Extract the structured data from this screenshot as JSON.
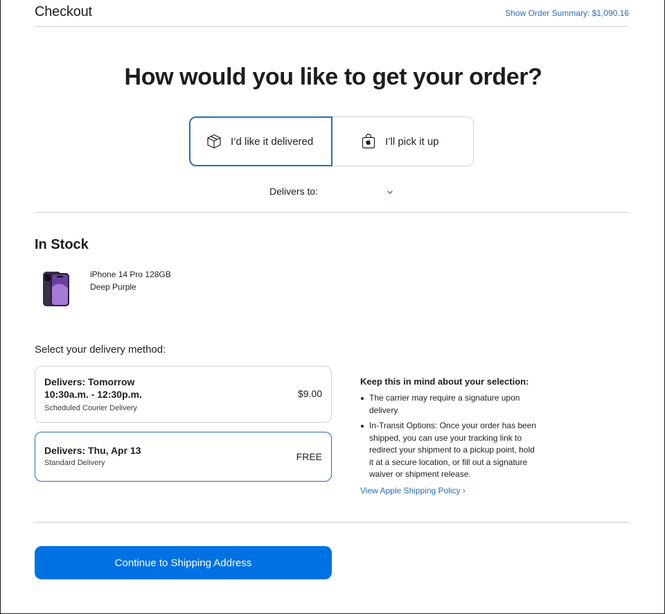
{
  "header": {
    "title": "Checkout",
    "order_summary": "Show Order Summary: $1,090.16"
  },
  "headline": "How would you like to get your order?",
  "fulfillment": {
    "deliver": {
      "label": "I’d like it delivered",
      "icon": "box-icon",
      "selected": true
    },
    "pickup": {
      "label": "I’ll pick it up",
      "icon": "apple-bag-icon",
      "selected": false
    }
  },
  "delivers_to": {
    "label": "Delivers to:",
    "value": ""
  },
  "stock": {
    "heading": "In Stock",
    "product": {
      "name": "iPhone 14 Pro 128GB",
      "color": "Deep Purple"
    }
  },
  "delivery": {
    "label": "Select your delivery method:",
    "options": [
      {
        "title_line1": "Delivers: Tomorrow",
        "title_line2": "10:30a.m. - 12:30p.m.",
        "subtitle": "Scheduled Courier Delivery",
        "price": "$9.00",
        "selected": false
      },
      {
        "title_line1": "Delivers: Thu, Apr 13",
        "subtitle": "Standard Delivery",
        "price": "FREE",
        "selected": true
      }
    ]
  },
  "info": {
    "heading": "Keep this in mind about your selection:",
    "notes": [
      "The carrier may require a signature upon delivery.",
      "In-Transit Options: Once your order has been shipped, you can use your tracking link to redirect your shipment to a pickup point, hold it at a secure location, or fill out a signature waiver or shipment release."
    ],
    "policy_link": "View Apple Shipping Policy ›"
  },
  "cta": {
    "label": "Continue to Shipping Address"
  },
  "colors": {
    "accent": "#0071e3",
    "link": "#2a6cb5",
    "selected_border": "#2b6cb0",
    "divider": "#d2d2d7"
  }
}
